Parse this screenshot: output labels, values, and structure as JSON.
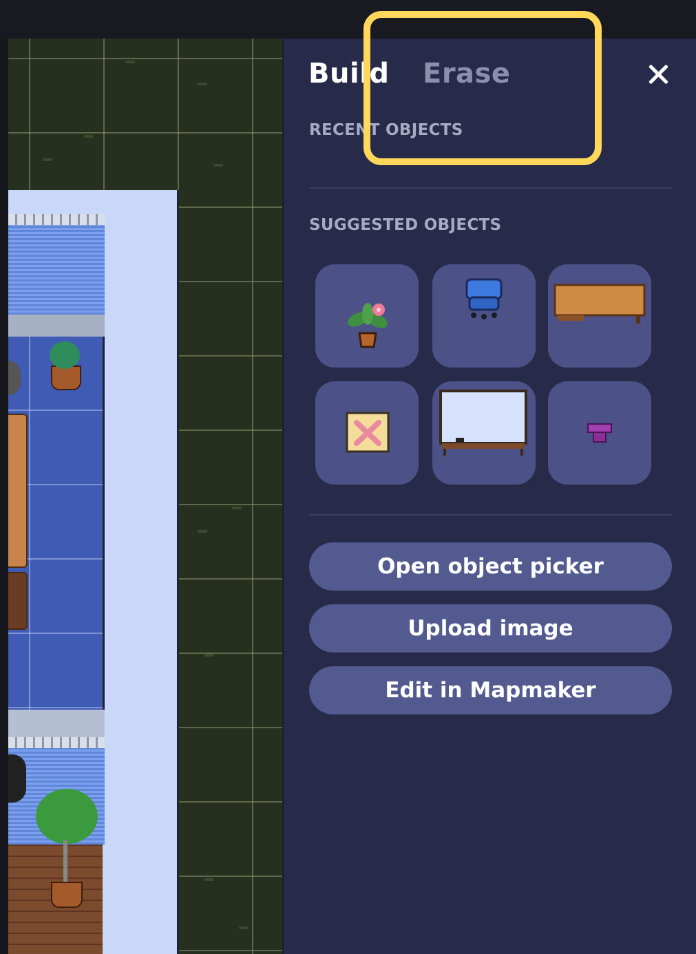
{
  "panel": {
    "tabs": [
      {
        "label": "Build",
        "active": true
      },
      {
        "label": "Erase",
        "active": false
      }
    ],
    "close_icon": "close-icon",
    "recent_label": "RECENT OBJECTS",
    "suggested_label": "SUGGESTED OBJECTS",
    "suggested_objects": [
      {
        "name": "potted-flower-plant"
      },
      {
        "name": "blue-office-chair"
      },
      {
        "name": "wooden-desk"
      },
      {
        "name": "x-marked-sticky-note"
      },
      {
        "name": "whiteboard"
      },
      {
        "name": "purple-block-piece"
      }
    ],
    "buttons": {
      "open_picker": "Open object picker",
      "upload_image": "Upload image",
      "edit_mapmaker": "Edit in Mapmaker"
    }
  },
  "colors": {
    "panel_bg": "#272a48",
    "tile_bg": "#4c5287",
    "button_bg": "#525a8f",
    "highlight": "#ffd75a"
  }
}
